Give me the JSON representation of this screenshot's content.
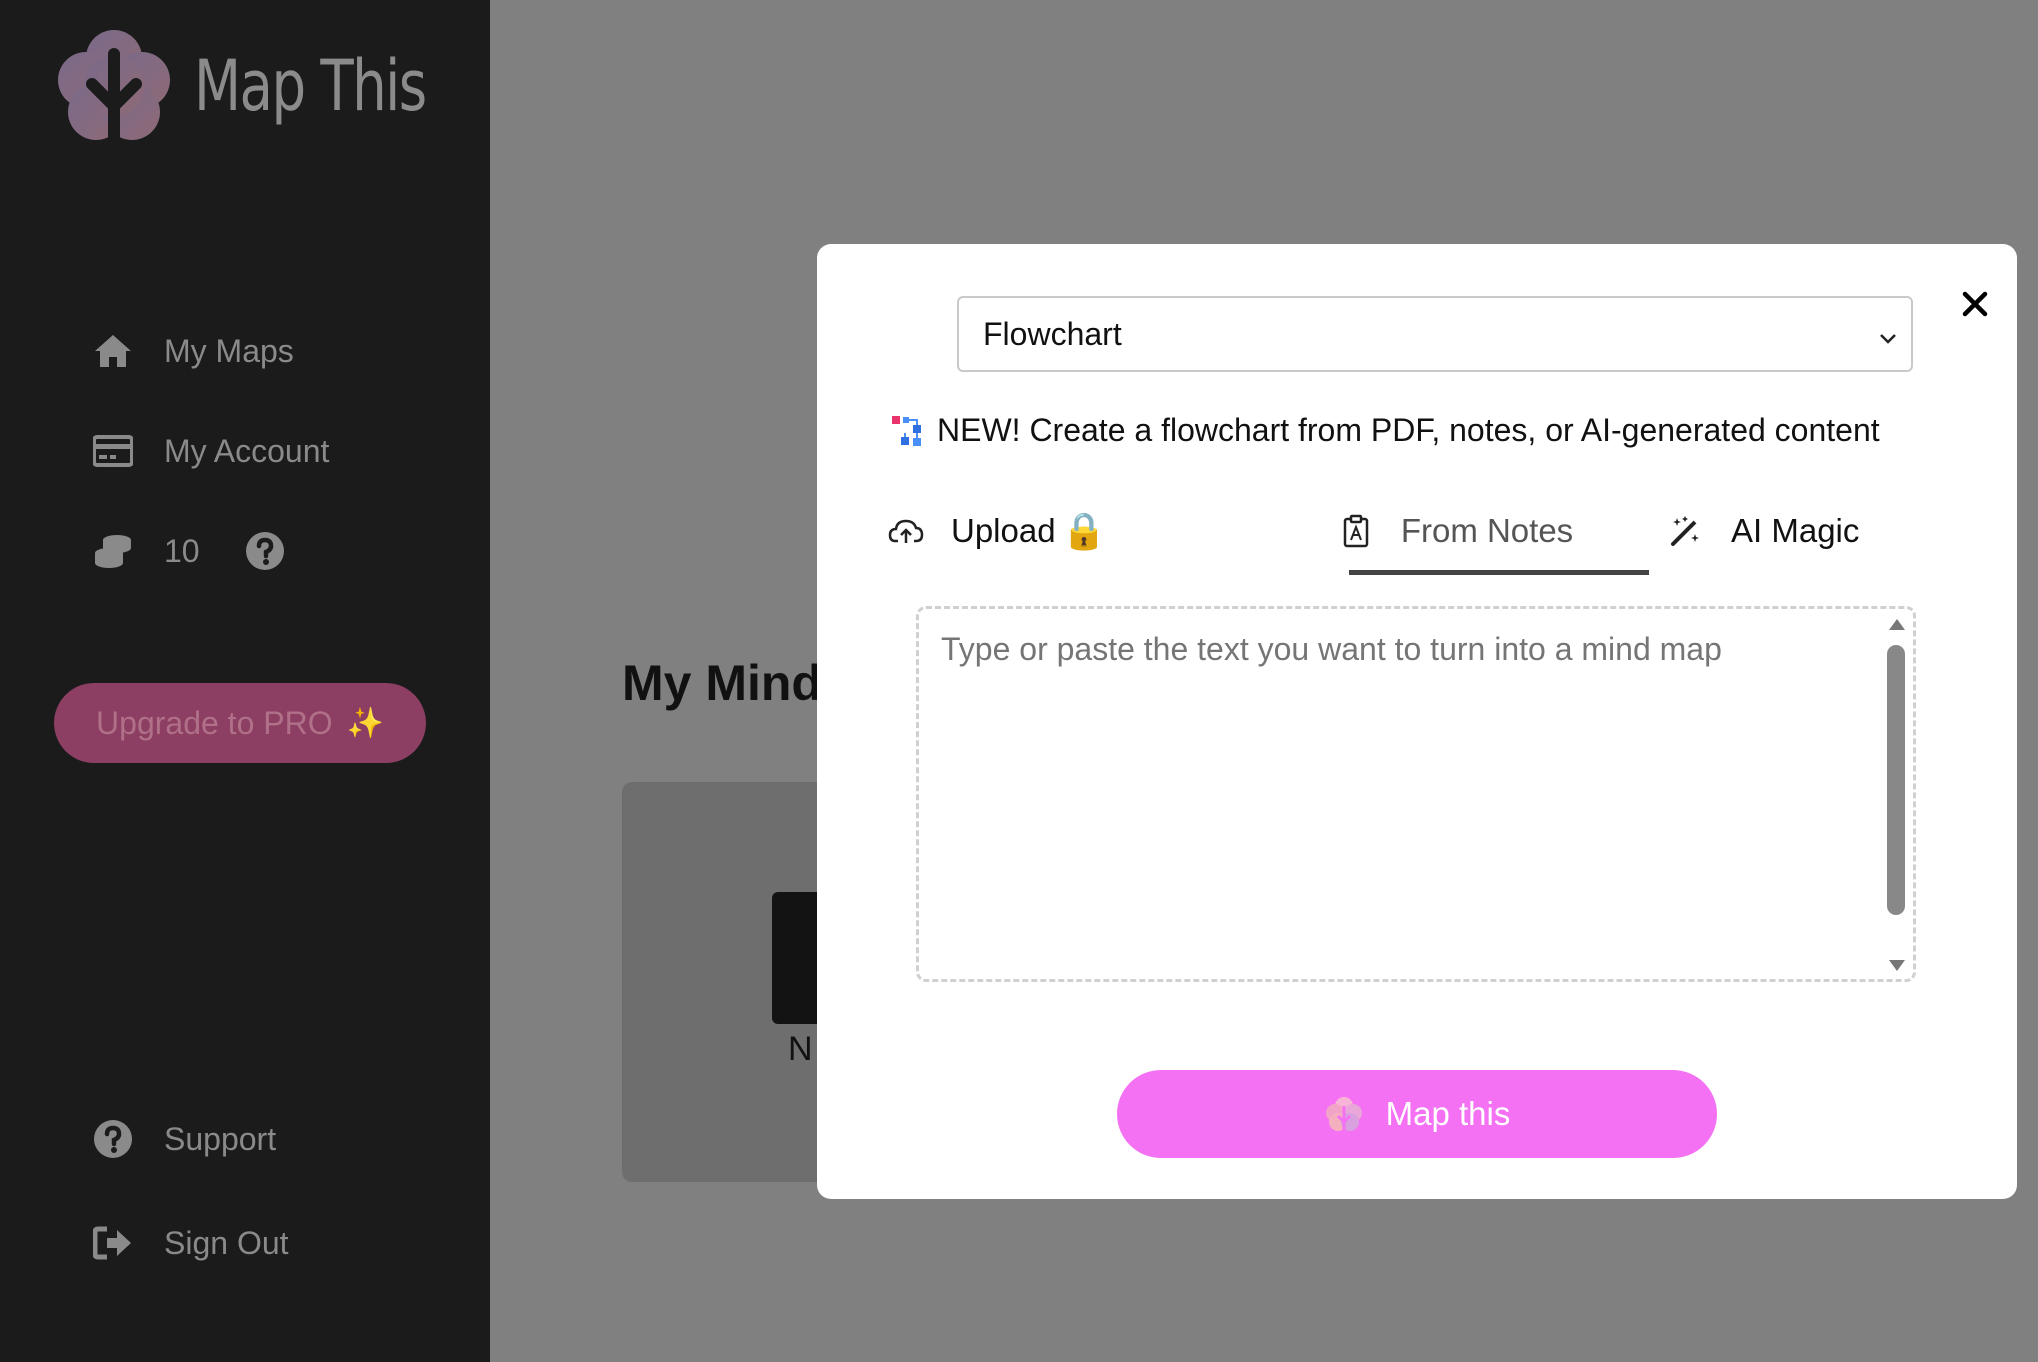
{
  "app": {
    "name": "Map This"
  },
  "sidebar": {
    "items": [
      {
        "label": "My Maps",
        "icon": "home-icon"
      },
      {
        "label": "My Account",
        "icon": "credit-card-icon"
      }
    ],
    "credits": {
      "count": "10",
      "icon": "coins-icon",
      "help_icon": "question-circle-icon"
    },
    "upgrade": {
      "label": "Upgrade to PRO",
      "sparkle": "✨"
    },
    "footer_items": [
      {
        "label": "Support",
        "icon": "question-circle-icon"
      },
      {
        "label": "Sign Out",
        "icon": "sign-out-icon"
      }
    ]
  },
  "background": {
    "heading": "My Mind",
    "card_label": "N"
  },
  "modal": {
    "type_select": {
      "value": "Flowchart"
    },
    "announcement": "NEW! Create a flowchart from PDF, notes, or AI-generated content",
    "tabs": [
      {
        "label": "Upload",
        "icon": "cloud-upload-icon",
        "badge": "🔒",
        "active": false
      },
      {
        "label": "From Notes",
        "icon": "clipboard-icon",
        "active": true
      },
      {
        "label": "AI Magic",
        "icon": "magic-wand-icon",
        "active": false
      }
    ],
    "notes_input": {
      "placeholder": "Type or paste the text you want to turn into a mind map",
      "value": ""
    },
    "submit": {
      "label": "Map this"
    }
  },
  "colors": {
    "sidebar_bg": "#1b1b1b",
    "overlay_bg": "#808080",
    "upgrade_bg": "#8c3f63",
    "submit_bg": "#f471f4"
  }
}
